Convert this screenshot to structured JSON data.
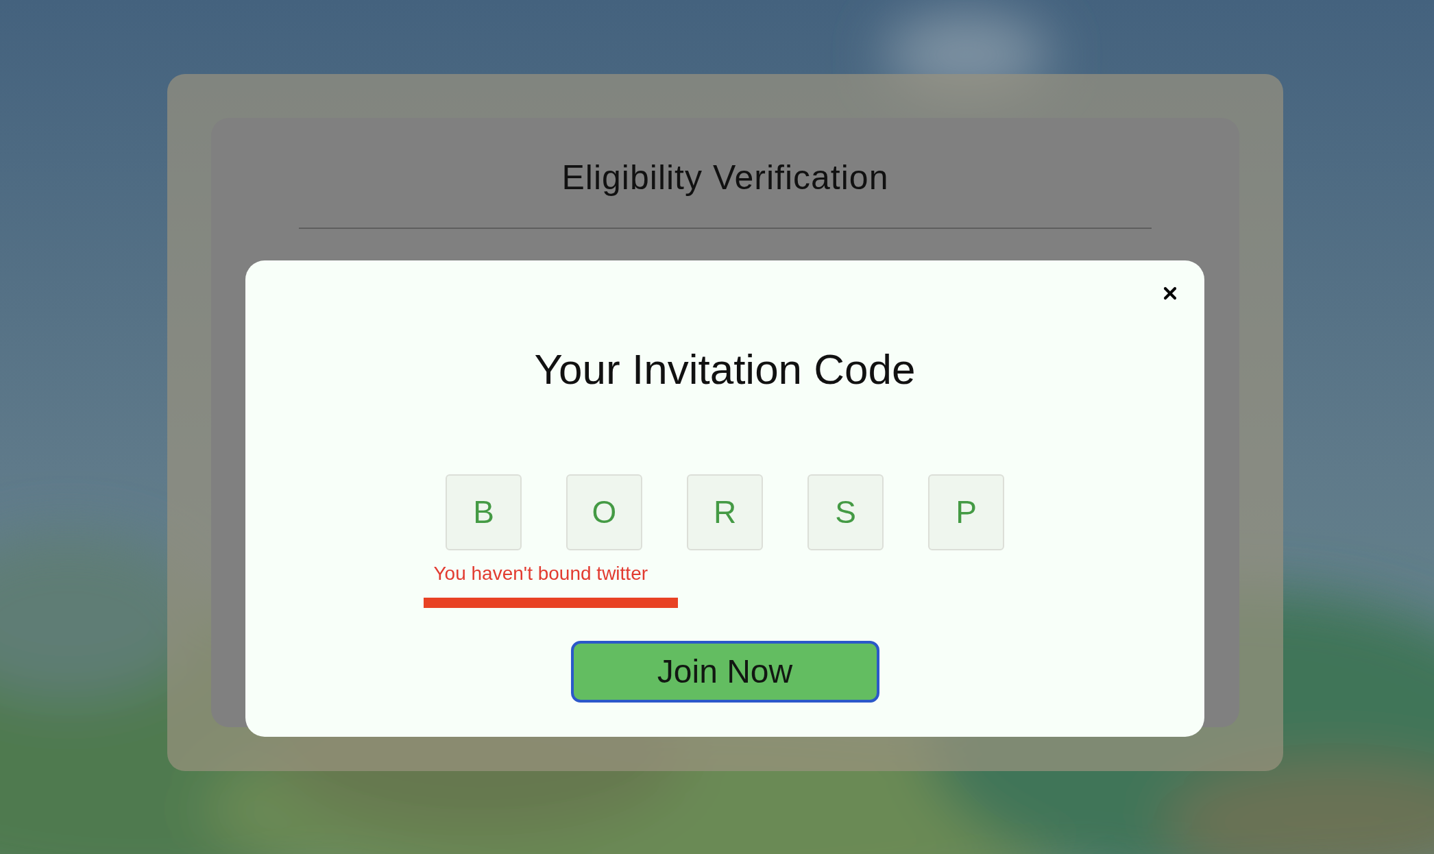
{
  "page": {
    "title": "Eligibility Verification"
  },
  "modal": {
    "title": "Your Invitation Code",
    "code": [
      "B",
      "O",
      "R",
      "S",
      "P"
    ],
    "error": "You haven't bound twitter",
    "button": "Join Now"
  }
}
